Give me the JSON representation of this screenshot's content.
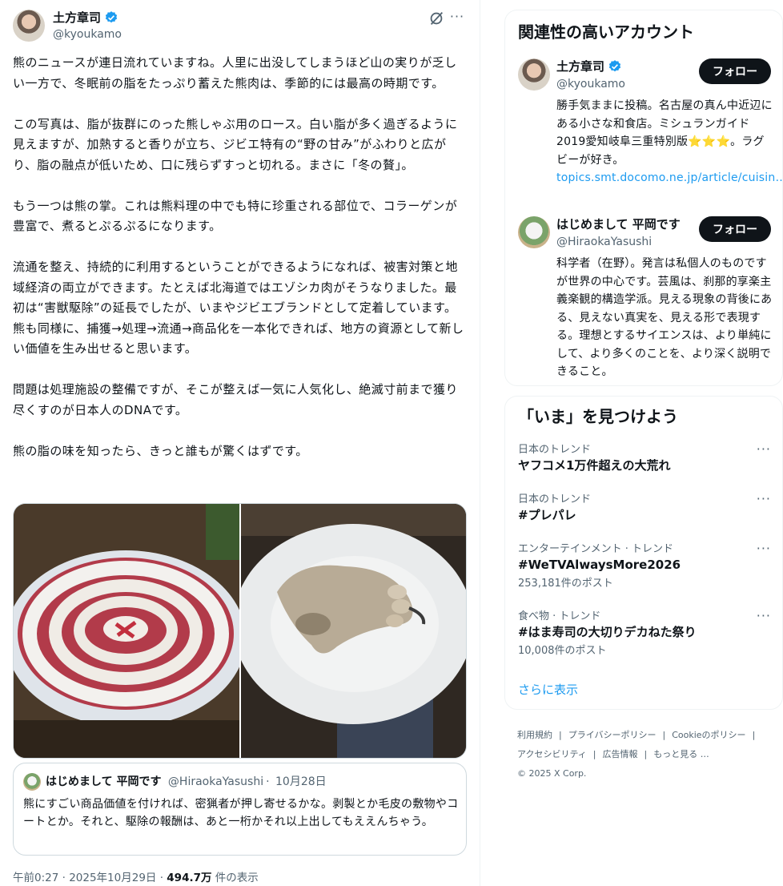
{
  "tweet": {
    "author": {
      "name": "土方章司",
      "handle": "@kyoukamo"
    },
    "paragraphs": [
      "熊のニュースが連日流れていますね。人里に出没してしまうほど山の実りが乏しい一方で、冬眠前の脂をたっぷり蓄えた熊肉は、季節的には最高の時期です。",
      "この写真は、脂が抜群にのった熊しゃぶ用のロース。白い脂が多く過ぎるように見えますが、加熱すると香りが立ち、ジビエ特有の“野の甘み”がふわりと広がり、脂の融点が低いため、口に残らずすっと切れる。まさに「冬の贅」。",
      "もう一つは熊の掌。これは熊料理の中でも特に珍重される部位で、コラーゲンが豊富で、煮るとぷるぷるになります。",
      "流通を整え、持続的に利用するということができるようになれば、被害対策と地域経済の両立ができます。たとえば北海道ではエゾシカ肉がそうなりました。最初は“害獣駆除”の延長でしたが、いまやジビエブランドとして定着しています。熊も同様に、捕獲→処理→流通→商品化を一本化できれば、地方の資源として新しい価値を生み出せると思います。",
      "問題は処理施設の整備ですが、そこが整えば一気に人気化し、絶滅寸前まで獲り尽くすのが日本人のDNAです。",
      "熊の脂の味を知ったら、きっと誰もが驚くはずです。"
    ],
    "quote": {
      "name": "はじめまして 平岡です",
      "handle": "@HiraokaYasushi",
      "date": "10月28日",
      "text": "熊にすごい商品価値を付ければ、密猟者が押し寄せるかな。剥製とか毛皮の敷物やコートとか。それと、駆除の報酬は、あと一桁かそれ以上出してもええんちゃう。"
    },
    "timestamp": "午前0:27 · 2025年10月29日 · ",
    "views": "494.7万",
    "views_suffix": " 件の表示"
  },
  "related": {
    "title": "関連性の高いアカウント",
    "accounts": [
      {
        "name": "土方章司",
        "handle": "@kyoukamo",
        "follow_label": "フォロー",
        "bio": "勝手気ままに投稿。名古屋の真ん中近辺にある小さな和食店。ミシュランガイド2019愛知岐阜三重特別版",
        "bio_stars": "⭐⭐⭐",
        "bio_after": "。ラグビーが好き。",
        "bio_link": "topics.smt.docomo.ne.jp/article/cuisin…"
      },
      {
        "name": "はじめまして 平岡です",
        "handle": "@HiraokaYasushi",
        "follow_label": "フォロー",
        "bio": "科学者（在野）。発言は私個人のものですが世界の中心です。芸風は、刹那的享楽主義楽観的構造学派。見える現象の背後にある、見えない真実を、見える形で表現する。理想とするサイエンスは、より単純にして、より多くのことを、より深く説明できること。"
      }
    ]
  },
  "trends": {
    "title": "「いま」を見つけよう",
    "items": [
      {
        "category": "日本のトレンド",
        "name": "ヤフコメ1万件超えの大荒れ",
        "count": ""
      },
      {
        "category": "日本のトレンド",
        "name": "#プレパレ",
        "count": ""
      },
      {
        "category": "エンターテインメント · トレンド",
        "name": "#WeTVAlwaysMore2026",
        "count": "253,181件のポスト"
      },
      {
        "category": "食べ物 · トレンド",
        "name": "#はま寿司の大切りデカねた祭り",
        "count": "10,008件のポスト"
      }
    ],
    "show_more": "さらに表示"
  },
  "footer": {
    "terms": "利用規約",
    "privacy": "プライバシーポリシー",
    "cookie": "Cookieのポリシー",
    "accessibility": "アクセシビリティ",
    "ads": "広告情報",
    "more": "もっと見る …",
    "copyright": "© 2025 X Corp."
  },
  "colors": {
    "accent": "#1d9bf0",
    "verified": "#1d9bf0",
    "text": "#0f1419",
    "muted": "#536471"
  }
}
